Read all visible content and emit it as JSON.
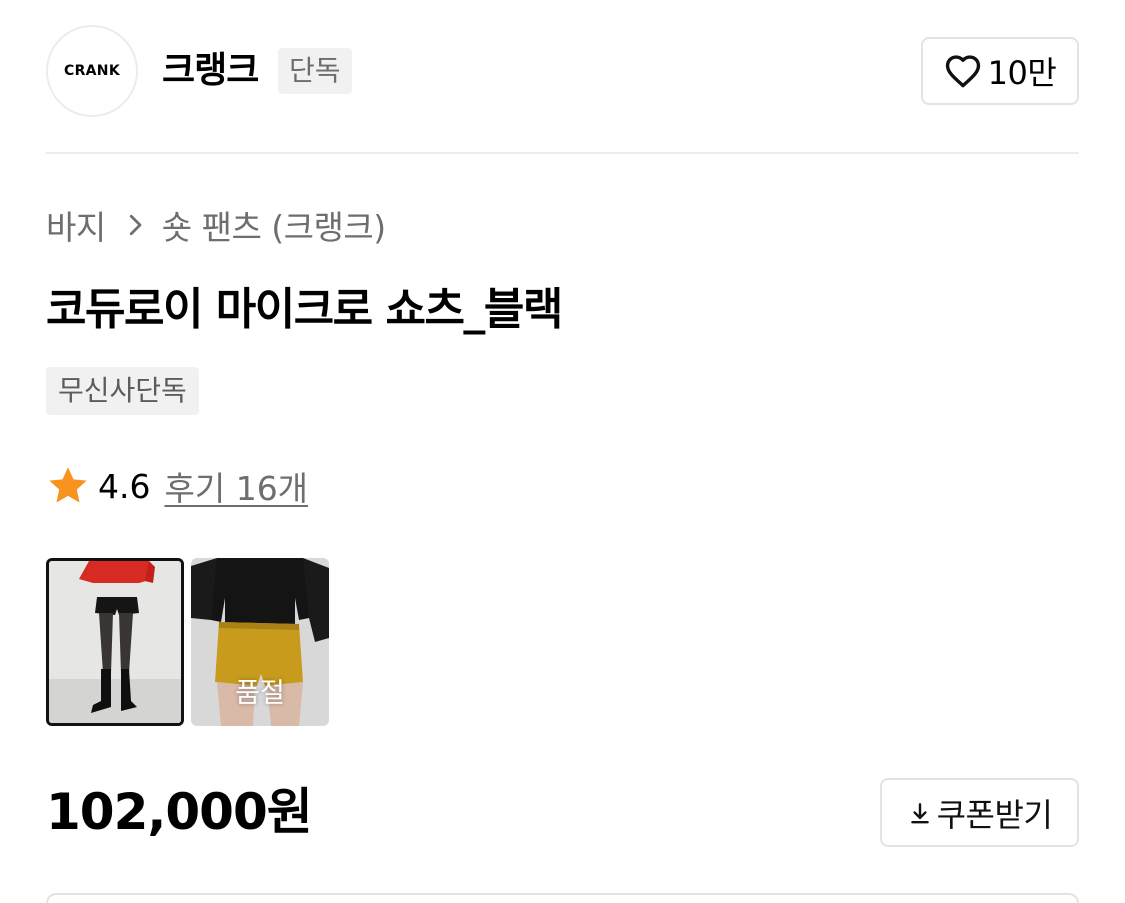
{
  "brand": {
    "logo_text": "CRANK",
    "name": "크랭크",
    "badge": "단독",
    "like_count": "10만",
    "like_icon": "heart-outline-icon"
  },
  "breadcrumb": {
    "items": [
      "바지",
      "숏 팬츠 (크랭크)"
    ],
    "separator_icon": "chevron-right-icon"
  },
  "product": {
    "title": "코듀로이 마이크로 쇼츠_블랙",
    "tag": "무신사단독",
    "rating": "4.6",
    "reviews_label": "후기 16개",
    "rating_icon": "star-icon",
    "star_color": "#f7931e"
  },
  "thumbnails": [
    {
      "color_variant": "black",
      "selected": true
    },
    {
      "color_variant": "yellow",
      "selected": false,
      "status": "품절"
    }
  ],
  "price": {
    "amount": "102,000원",
    "coupon_label": "쿠폰받기",
    "coupon_icon": "download-icon"
  }
}
